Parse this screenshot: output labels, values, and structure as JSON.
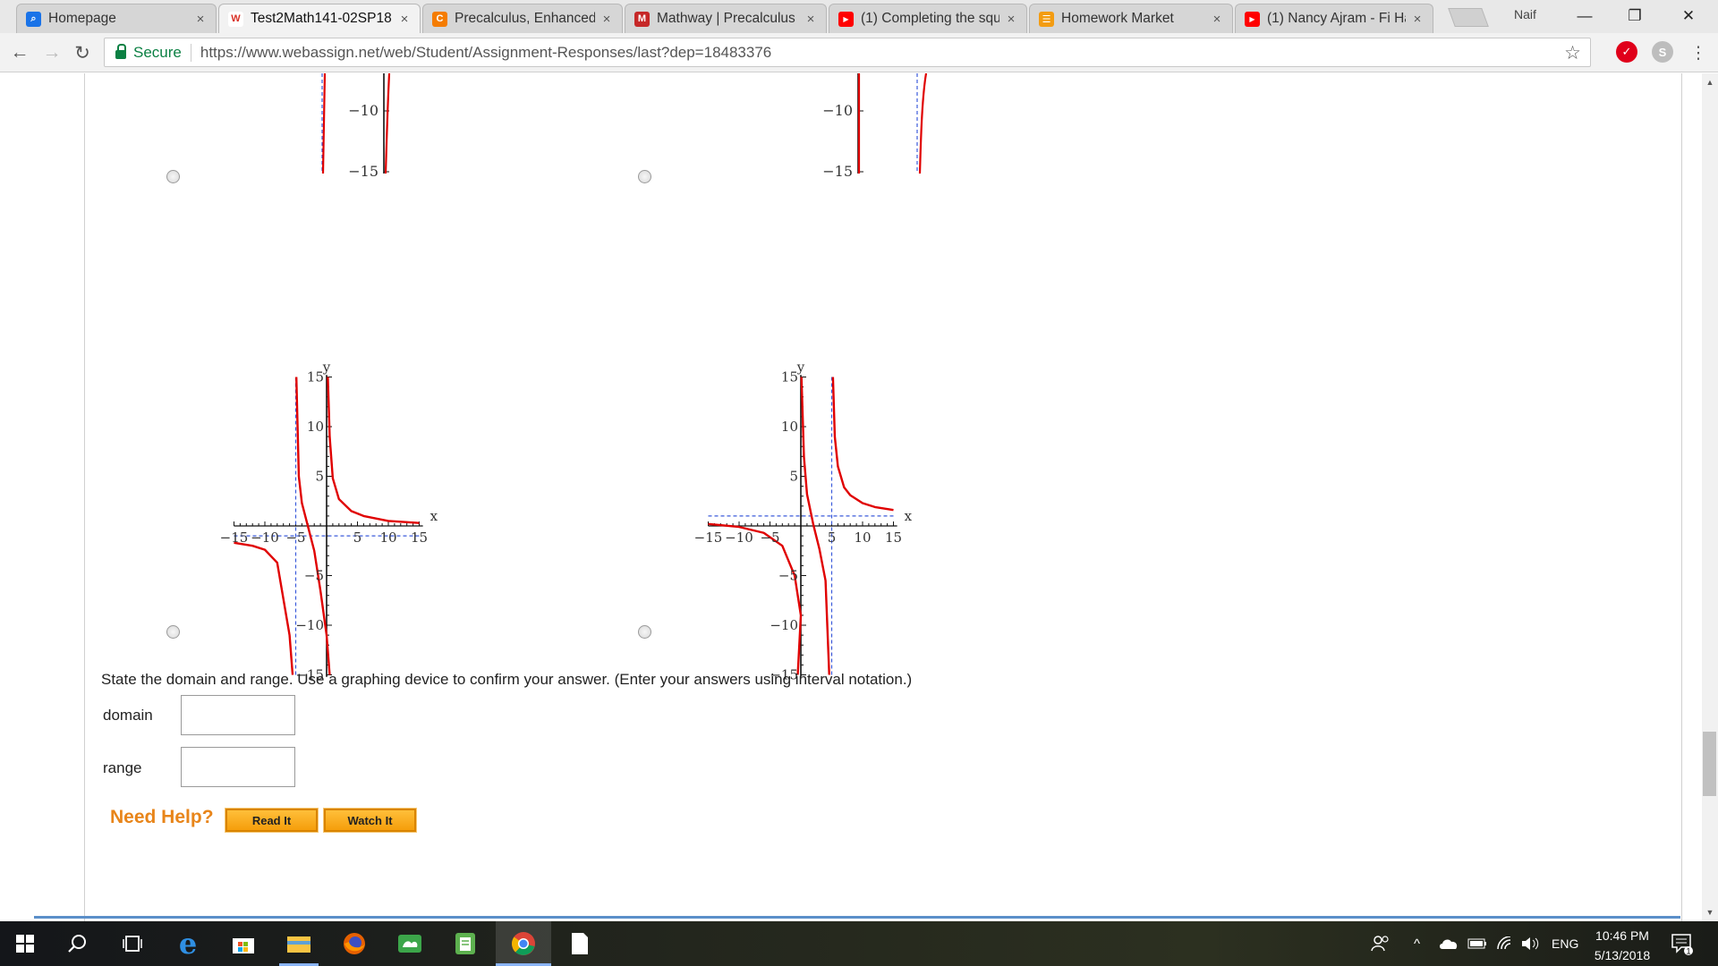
{
  "browser": {
    "tabs": [
      {
        "title": "Homepage",
        "fav_color": "#1a73e8",
        "fav_glyph": "⌕"
      },
      {
        "title": "Test2Math141-02SP18",
        "fav_color": "#d93025",
        "fav_glyph": "W"
      },
      {
        "title": "Precalculus, Enhanced W",
        "fav_color": "#f57c00",
        "fav_glyph": "C"
      },
      {
        "title": "Mathway | Precalculus P",
        "fav_color": "#c62828",
        "fav_glyph": "M"
      },
      {
        "title": "(1) Completing the squ",
        "fav_color": "#ff0000",
        "fav_glyph": "▶"
      },
      {
        "title": "Homework Market",
        "fav_color": "#f39c12",
        "fav_glyph": "☰"
      },
      {
        "title": "(1) Nancy Ajram - Fi Ha",
        "fav_color": "#ff0000",
        "fav_glyph": "▶"
      }
    ],
    "close_glyph": "×",
    "profile_name": "Naif",
    "minimize_glyph": "—",
    "restore_glyph": "❐",
    "window_close_glyph": "✕",
    "back_glyph": "←",
    "forward_glyph": "→",
    "reload_glyph": "↻",
    "secure_label": "Secure",
    "url": "https://www.webassign.net/web/Student/Assignment-Responses/last?dep=18483376",
    "star_glyph": "☆",
    "menu_glyph": "⋮"
  },
  "graphs": {
    "ticks": {
      "y_pos": [
        "15",
        "10",
        "5"
      ],
      "y_neg": [
        "−5",
        "−10",
        "−15"
      ],
      "x_neg": [
        "−15",
        "−10",
        "−5"
      ],
      "x_pos": [
        "5",
        "10",
        "15"
      ]
    },
    "xlabel": "x",
    "ylabel": "y"
  },
  "chart_data": [
    {
      "type": "line",
      "position": "top-left (cropped)",
      "visible_y_ticks": [
        "−10",
        "−15"
      ],
      "vertical_asymptote": -5
    },
    {
      "type": "line",
      "position": "top-right (cropped)",
      "visible_y_ticks": [
        "−10",
        "−15"
      ],
      "vertical_asymptote": 5
    },
    {
      "type": "line",
      "xlabel": "x",
      "ylabel": "y",
      "xlim": [
        -15,
        15
      ],
      "ylim": [
        -15,
        15
      ],
      "vertical_asymptote": -5,
      "horizontal_asymptote": -1,
      "series": [
        {
          "x": [
            -15,
            -12,
            -10,
            -8,
            -6,
            -5.5
          ],
          "y": [
            -1.7,
            -2,
            -2.4,
            -3.7,
            -11,
            -15
          ]
        },
        {
          "x": [
            -4.9,
            -4.5,
            -4,
            -3,
            -2,
            -1,
            0,
            0.5
          ],
          "y": [
            15,
            5,
            2.3,
            -0.1,
            -2.5,
            -6.5,
            -11,
            -15
          ]
        },
        {
          "x": [
            0.2,
            0.5,
            1,
            2,
            4,
            6,
            10,
            15
          ],
          "y": [
            15,
            9,
            4.8,
            2.7,
            1.5,
            1,
            0.5,
            0.3
          ]
        }
      ]
    },
    {
      "type": "line",
      "xlabel": "x",
      "ylabel": "y",
      "xlim": [
        -15,
        15
      ],
      "ylim": [
        -15,
        15
      ],
      "vertical_asymptote": 5,
      "horizontal_asymptote": 1,
      "series": [
        {
          "x": [
            -15,
            -10,
            -6,
            -3,
            -1,
            0,
            -0.5
          ],
          "y": [
            0.2,
            -0.1,
            -0.7,
            -2,
            -5,
            -9,
            -15
          ]
        },
        {
          "x": [
            0.1,
            0.5,
            1,
            2,
            3,
            4,
            4.6
          ],
          "y": [
            15,
            7,
            3.2,
            0.2,
            -2.3,
            -5.5,
            -15
          ]
        },
        {
          "x": [
            5.2,
            5.5,
            6,
            7,
            8,
            10,
            12,
            15
          ],
          "y": [
            15,
            9,
            6,
            3.9,
            3.1,
            2.3,
            1.9,
            1.6
          ]
        }
      ]
    }
  ],
  "form": {
    "question": "State the domain and range. Use a graphing device to confirm your answer. (Enter your answers using interval notation.)",
    "domain_label": "domain",
    "domain_value": "",
    "range_label": "range",
    "range_value": "",
    "need_help": "Need Help?",
    "read_it": "Read It",
    "watch_it": "Watch It"
  },
  "taskbar": {
    "time": "10:46 PM",
    "date": "5/13/2018",
    "language": "ENG",
    "notification_count": "1"
  }
}
